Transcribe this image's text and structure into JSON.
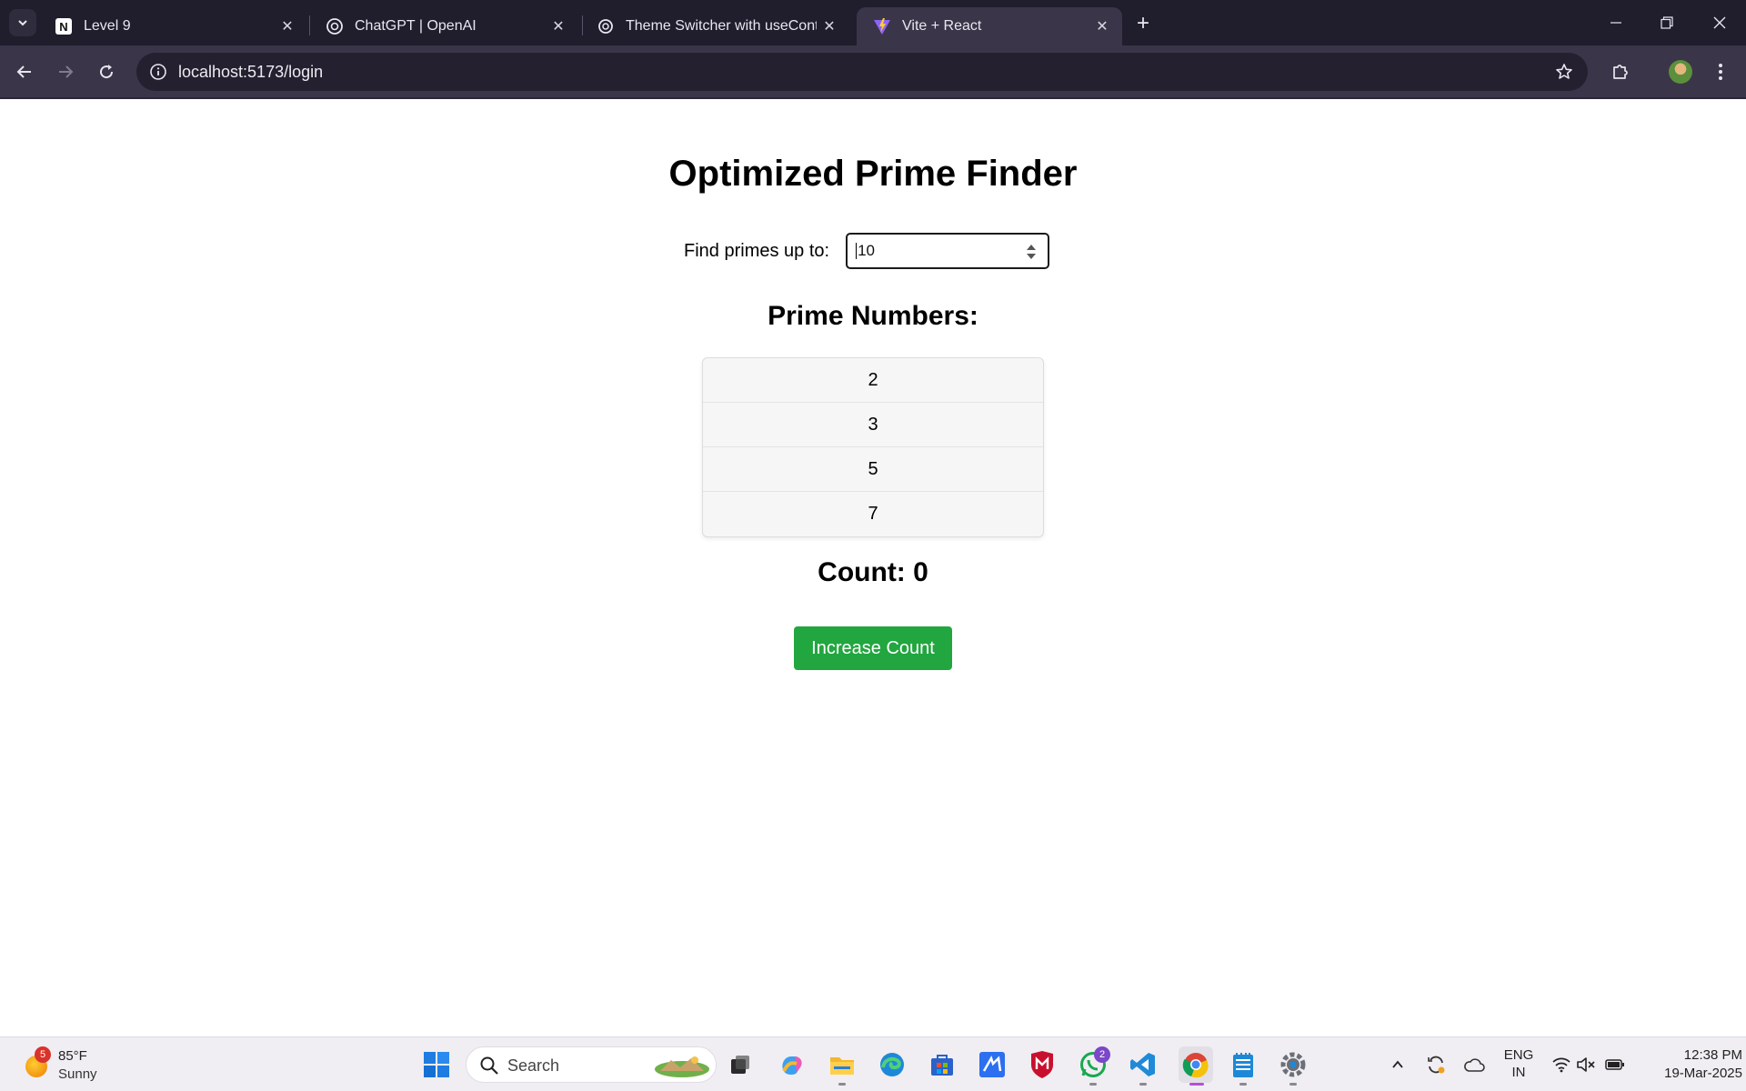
{
  "browser": {
    "tabs": [
      {
        "title": "Level 9",
        "icon": "notion-icon",
        "active": false
      },
      {
        "title": "ChatGPT | OpenAI",
        "icon": "openai-icon",
        "active": false
      },
      {
        "title": "Theme Switcher with useContext",
        "icon": "openai-icon",
        "active": false
      },
      {
        "title": "Vite + React",
        "icon": "vite-icon",
        "active": true
      }
    ],
    "url": "localhost:5173/login"
  },
  "page": {
    "title": "Optimized Prime Finder",
    "find_label": "Find primes up to:",
    "input_value": "10",
    "primes_heading": "Prime Numbers:",
    "primes": [
      "2",
      "3",
      "5",
      "7"
    ],
    "count_label": "Count: 0",
    "button_label": "Increase Count",
    "button_color": "#22a63f"
  },
  "taskbar": {
    "weather_badge": "5",
    "temperature": "85°F",
    "condition": "Sunny",
    "search_placeholder": "Search",
    "whatsapp_badge": "2",
    "language_line1": "ENG",
    "language_line2": "IN",
    "time": "12:38 PM",
    "date": "19-Mar-2025"
  }
}
